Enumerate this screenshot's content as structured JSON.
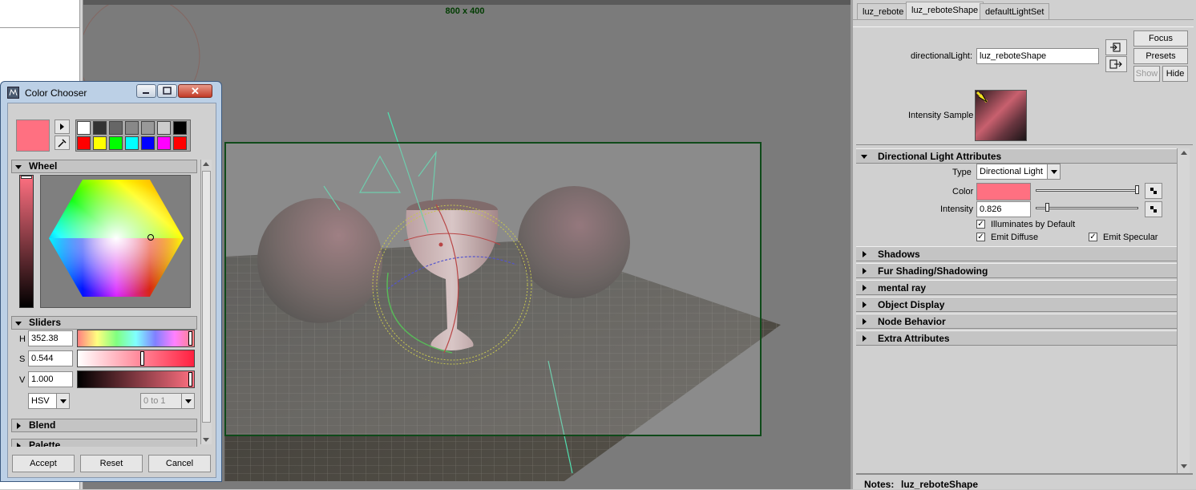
{
  "viewport": {
    "resolution_label": "800 x 400"
  },
  "attribute_editor": {
    "tabs": [
      "luz_rebote",
      "luz_reboteShape",
      "defaultLightSet"
    ],
    "active_tab": "luz_reboteShape",
    "node_type_label": "directionalLight:",
    "node_name": "luz_reboteShape",
    "buttons": {
      "focus": "Focus",
      "presets": "Presets",
      "show": "Show",
      "hide": "Hide"
    },
    "intensity_sample_label": "Intensity Sample",
    "sections": {
      "directional_light": {
        "title": "Directional Light Attributes",
        "type_label": "Type",
        "type_value": "Directional Light",
        "color_label": "Color",
        "color_value": "#ff7081",
        "intensity_label": "Intensity",
        "intensity_value": "0.826",
        "illuminates_by_default": "Illuminates by Default",
        "emit_diffuse": "Emit Diffuse",
        "emit_specular": "Emit Specular"
      },
      "collapsed": [
        "Shadows",
        "Fur Shading/Shadowing",
        "mental ray",
        "Object Display",
        "Node Behavior",
        "Extra Attributes"
      ]
    },
    "notes_label": "Notes:",
    "notes_value": "luz_reboteShape"
  },
  "color_chooser": {
    "title": "Color Chooser",
    "current_color": "#ff7081",
    "history_swatches_row1": [
      "#ffffff",
      "#333333",
      "#666666",
      "#888888",
      "#999999",
      "#cccccc",
      "#000000"
    ],
    "history_swatches_row2": [
      "#ff0000",
      "#ffff00",
      "#00ff00",
      "#00ffff",
      "#0000ff",
      "#ff00ff",
      "#ff0000"
    ],
    "wheel_section": "Wheel",
    "sliders_section": "Sliders",
    "h_label": "H",
    "h_value": "352.38",
    "s_label": "S",
    "s_value": "0.544",
    "v_label": "V",
    "v_value": "1.000",
    "mode_value": "HSV",
    "range_value": "0 to 1",
    "blend_section": "Blend",
    "palette_section": "Palette",
    "buttons": {
      "accept": "Accept",
      "reset": "Reset",
      "cancel": "Cancel"
    }
  }
}
